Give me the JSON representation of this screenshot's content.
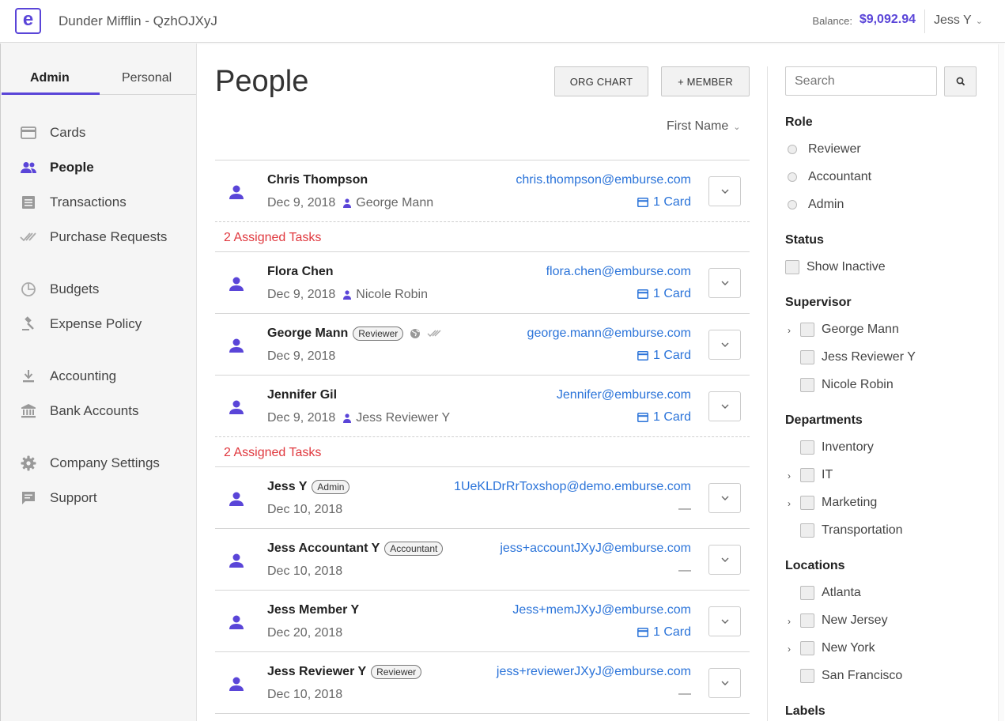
{
  "header": {
    "logo_letter": "e",
    "company": "Dunder Mifflin - QzhOJXyJ",
    "balance_label": "Balance:",
    "balance_value": "$9,092.94",
    "user": "Jess Y"
  },
  "sidebar": {
    "tabs": [
      "Admin",
      "Personal"
    ],
    "items": [
      {
        "label": "Cards",
        "icon": "card-icon"
      },
      {
        "label": "People",
        "icon": "people-icon"
      },
      {
        "label": "Transactions",
        "icon": "receipt-icon"
      },
      {
        "label": "Purchase Requests",
        "icon": "double-check-icon"
      },
      {
        "label": "Budgets",
        "icon": "pie-chart-icon"
      },
      {
        "label": "Expense Policy",
        "icon": "gavel-icon"
      },
      {
        "label": "Accounting",
        "icon": "download-icon"
      },
      {
        "label": "Bank Accounts",
        "icon": "bank-icon"
      },
      {
        "label": "Company Settings",
        "icon": "gear-icon"
      },
      {
        "label": "Support",
        "icon": "chat-icon"
      }
    ]
  },
  "main": {
    "title": "People",
    "org_chart_label": "ORG CHART",
    "add_member_label": "+ MEMBER",
    "sort_label": "First Name",
    "people": [
      {
        "name": "Chris Thompson",
        "badge": "",
        "date": "Dec 9, 2018",
        "supervisor": "George Mann",
        "email": "chris.thompson@emburse.com",
        "cards": "1 Card"
      },
      {
        "name": "Flora Chen",
        "badge": "",
        "date": "Dec 9, 2018",
        "supervisor": "Nicole Robin",
        "email": "flora.chen@emburse.com",
        "cards": "1 Card"
      },
      {
        "name": "George Mann",
        "badge": "Reviewer",
        "date": "Dec 9, 2018",
        "supervisor": "",
        "email": "george.mann@emburse.com",
        "cards": "1 Card"
      },
      {
        "name": "Jennifer Gil",
        "badge": "",
        "date": "Dec 9, 2018",
        "supervisor": "Jess Reviewer Y",
        "email": "Jennifer@emburse.com",
        "cards": "1 Card"
      },
      {
        "name": "Jess Y",
        "badge": "Admin",
        "date": "Dec 10, 2018",
        "supervisor": "",
        "email": "1UeKLDrRrToxshop@demo.emburse.com",
        "cards": "—"
      },
      {
        "name": "Jess Accountant Y",
        "badge": "Accountant",
        "date": "Dec 10, 2018",
        "supervisor": "",
        "email": "jess+accountJXyJ@emburse.com",
        "cards": "—"
      },
      {
        "name": "Jess Member Y",
        "badge": "",
        "date": "Dec 20, 2018",
        "supervisor": "",
        "email": "Jess+memJXyJ@emburse.com",
        "cards": "1 Card"
      },
      {
        "name": "Jess Reviewer Y",
        "badge": "Reviewer",
        "date": "Dec 10, 2018",
        "supervisor": "",
        "email": "jess+reviewerJXyJ@emburse.com",
        "cards": "—"
      }
    ],
    "assigned_tasks": [
      "2 Assigned Tasks",
      "2 Assigned Tasks"
    ]
  },
  "filters": {
    "search_placeholder": "Search",
    "role_heading": "Role",
    "roles": [
      "Reviewer",
      "Accountant",
      "Admin"
    ],
    "status_heading": "Status",
    "status_option": "Show Inactive",
    "supervisor_heading": "Supervisor",
    "supervisors": [
      "George Mann",
      "Jess Reviewer Y",
      "Nicole Robin"
    ],
    "departments_heading": "Departments",
    "departments": [
      "Inventory",
      "IT",
      "Marketing",
      "Transportation"
    ],
    "locations_heading": "Locations",
    "locations": [
      "Atlanta",
      "New Jersey",
      "New York",
      "San Francisco"
    ],
    "labels_heading": "Labels"
  },
  "colors": {
    "brand": "#5a45d8",
    "link": "#2a73d9",
    "alert": "#e0383e"
  }
}
